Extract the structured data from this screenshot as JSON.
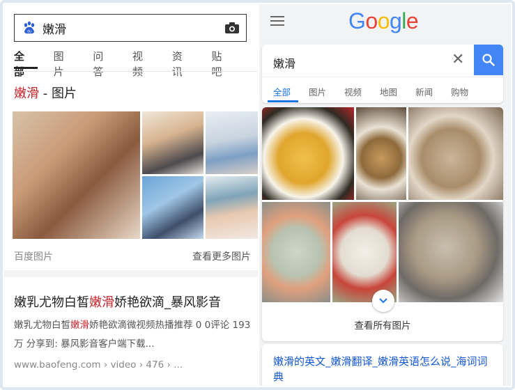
{
  "baidu": {
    "query": "嫩滑",
    "tabs": [
      "全部",
      "图片",
      "问答",
      "视频",
      "资讯",
      "贴吧"
    ],
    "image_section": {
      "title_hl": "嫩滑",
      "title_rest": " - 图片",
      "source": "百度图片",
      "more": "查看更多图片"
    },
    "result": {
      "title_a": "嫩乳尤物白皙",
      "title_hl": "嫩滑",
      "title_b": "娇艳欲滴_暴风影音",
      "desc_a": "嫩乳尤物白皙",
      "desc_hl": "嫩滑",
      "desc_b": "娇艳欲滴微视频热播推荐 0 0评论 193万 分享到: 暴风影音客户端下载...",
      "url": "www.baofeng.com › video › 476 › ..."
    }
  },
  "google": {
    "logo": "Google",
    "query": "嫩滑",
    "tabs": [
      "全部",
      "图片",
      "视频",
      "地图",
      "新闻",
      "购物"
    ],
    "view_all": "查看所有图片",
    "first_result": "嫩滑的英文_嫩滑翻译_嫩滑英语怎么说_海词词典"
  },
  "colors": {
    "baidu_highlight": "#c8252c",
    "google_blue": "#4285f4",
    "google_link": "#1558d6"
  }
}
